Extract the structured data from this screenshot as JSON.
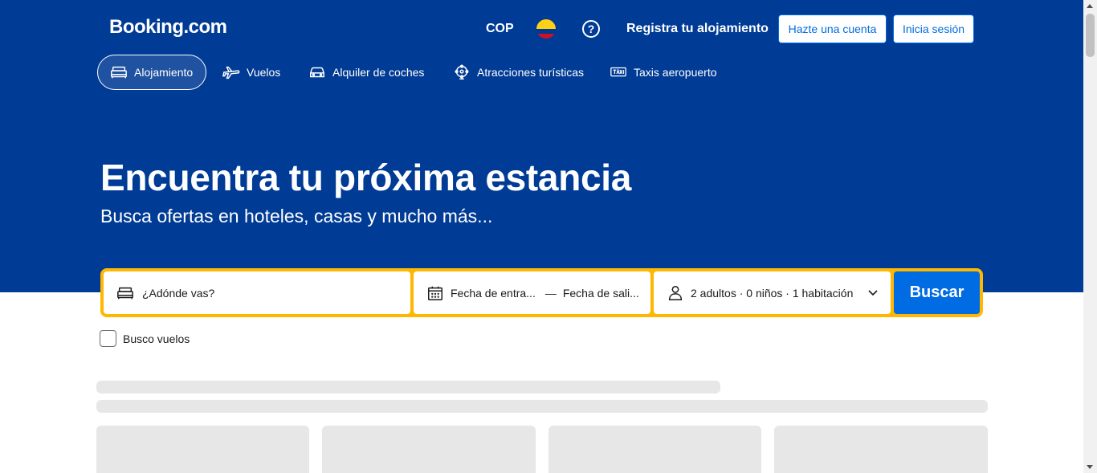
{
  "brand": {
    "logo": "Booking.com",
    "color_primary": "#003b95",
    "color_accent": "#ffb700",
    "color_button": "#006ce4"
  },
  "header": {
    "currency": "COP",
    "flag_icon": "colombia-flag-icon",
    "help_icon": "question-circle-icon",
    "help_glyph": "?",
    "list_property": "Registra tu alojamiento",
    "register_button": "Hazte una cuenta",
    "login_button": "Inicia sesión"
  },
  "nav": {
    "items": [
      {
        "label": "Alojamiento",
        "icon": "bed-icon",
        "active": true
      },
      {
        "label": "Vuelos",
        "icon": "airplane-icon",
        "active": false
      },
      {
        "label": "Alquiler de coches",
        "icon": "car-icon",
        "active": false
      },
      {
        "label": "Atracciones turísticas",
        "icon": "attractions-icon",
        "active": false
      },
      {
        "label": "Taxis aeropuerto",
        "icon": "taxi-icon",
        "active": false
      }
    ]
  },
  "hero": {
    "title": "Encuentra tu próxima estancia",
    "subtitle": "Busca ofertas en hoteles, casas y mucho más..."
  },
  "search": {
    "destination_placeholder": "¿Adónde vas?",
    "checkin_placeholder": "Fecha de entra...",
    "date_separator": "—",
    "checkout_placeholder": "Fecha de sali...",
    "guests_value": "2 adultos · 0 niños · 1 habitación",
    "search_button": "Buscar"
  },
  "flights_checkbox": {
    "label": "Busco vuelos",
    "checked": false
  }
}
